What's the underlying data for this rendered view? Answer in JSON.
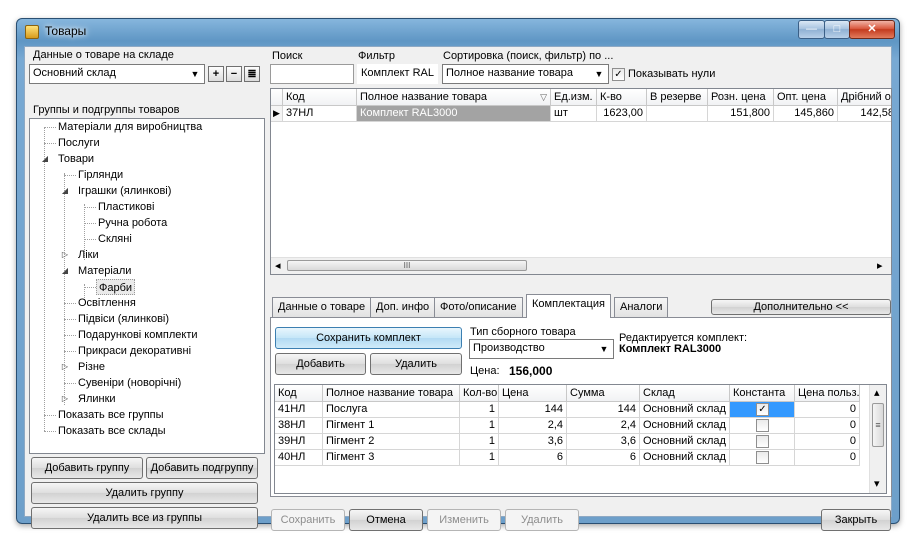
{
  "window": {
    "title": "Товары",
    "min": "—",
    "max": "□",
    "close": "✕"
  },
  "left": {
    "stock_label": "Данные о товаре на складе",
    "warehouse": "Основний склад",
    "add_glyph": "+",
    "remove_glyph": "−",
    "doc_glyph": "≣",
    "groups_label": "Группы и подгруппы товаров",
    "tree": [
      "Матеріали для виробництва",
      "Послуги",
      "Товари",
      "Гірлянди",
      "Іграшки (ялинкові)",
      "Пластикові",
      "Ручна робота",
      "Скляні",
      "Ліки",
      "Матеріали",
      "Фарби",
      "Освітлення",
      "Підвіси (ялинкові)",
      "Подарункові комплекти",
      "Прикраси декоративні",
      "Різне",
      "Сувеніри (новорічні)",
      "Ялинки",
      "Показать все группы",
      "Показать все склады"
    ],
    "btn_add_group": "Добавить группу",
    "btn_add_subgroup": "Добавить подгруппу",
    "btn_delete_group": "Удалить группу",
    "btn_delete_all": "Удалить все из группы"
  },
  "top": {
    "search_label": "Поиск",
    "search_value": "",
    "filter_label": "Фильтр",
    "filter_value": "Комплект RAL",
    "sort_label": "Сортировка (поиск, фильтр) по ...",
    "sort_value": "Полное название товара",
    "show_zero_label": "Показывать нули",
    "show_zero_checked": "✓"
  },
  "products": {
    "headers": [
      "Код",
      "Полное название товара",
      "Ед.изм.",
      "К-во",
      "В резерве",
      "Розн. цена",
      "Опт. цена",
      "Дрібний о"
    ],
    "sort_glyph": "▽",
    "rows": [
      {
        "code": "37НЛ",
        "name": "Комплект RAL3000",
        "unit": "шт",
        "qty": "1623,00",
        "reserve": "",
        "retail": "151,800",
        "wholesale": "145,860",
        "small": "142,58"
      }
    ]
  },
  "tabs": [
    "Данные о товаре",
    "Доп. инфо",
    "Фото/описание",
    "Комплектация",
    "Аналоги"
  ],
  "extra_button": "Дополнительно <<",
  "kit": {
    "btn_save_kit": "Сохранить комплект",
    "btn_add": "Добавить",
    "btn_delete": "Удалить",
    "type_label": "Тип сборного товара",
    "type_value": "Производство",
    "editing_label": "Редактируется комплект:",
    "editing_value": "Комплект RAL3000",
    "price_label": "Цена:",
    "price_value": "156,000",
    "headers": [
      "Код",
      "Полное название товара",
      "Кол-во",
      "Цена",
      "Сумма",
      "Склад",
      "Константа",
      "Цена польз."
    ],
    "rows": [
      {
        "code": "41НЛ",
        "name": "Послуга",
        "qty": "1",
        "price": "144",
        "sum": "144",
        "store": "Основний склад",
        "const": "✓",
        "user_price": "0"
      },
      {
        "code": "38НЛ",
        "name": "Пігмент 1",
        "qty": "1",
        "price": "2,4",
        "sum": "2,4",
        "store": "Основний склад",
        "const": "",
        "user_price": "0"
      },
      {
        "code": "39НЛ",
        "name": "Пігмент 2",
        "qty": "1",
        "price": "3,6",
        "sum": "3,6",
        "store": "Основний склад",
        "const": "",
        "user_price": "0"
      },
      {
        "code": "40НЛ",
        "name": "Пігмент 3",
        "qty": "1",
        "price": "6",
        "sum": "6",
        "store": "Основний склад",
        "const": "",
        "user_price": "0"
      }
    ]
  },
  "bottom": {
    "save": "Сохранить",
    "cancel": "Отмена",
    "edit": "Изменить",
    "delete": "Удалить",
    "close": "Закрыть"
  },
  "scroll": {
    "left": "◂",
    "right": "▸",
    "up": "▴",
    "down": "▾",
    "grip": "III",
    "vgrip": "≡"
  },
  "combo_arrow": "▼",
  "colors": {
    "title_bg": "#6d9fca",
    "selection": "#3399ff",
    "row_selected": "#a3a3a3"
  }
}
